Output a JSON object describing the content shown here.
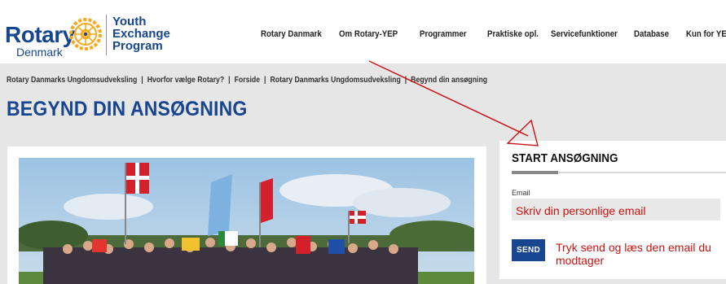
{
  "logo": {
    "rotary": "Rotary",
    "country": "Denmark",
    "program_line1": "Youth",
    "program_line2": "Exchange",
    "program_line3": "Program"
  },
  "nav": {
    "items": [
      "Rotary Danmark",
      "Om Rotary-YEP",
      "Programmer",
      "Praktiske opl.",
      "Servicefunktioner",
      "Database",
      "Kun for YEO'er"
    ]
  },
  "breadcrumb": {
    "items": [
      "Rotary Danmarks Ungdomsudveksling",
      "Hvorfor vælge Rotary?",
      "Forside",
      "Rotary Danmarks Ungdomsudveksling",
      "Begynd din ansøgning"
    ],
    "separator": "|"
  },
  "page": {
    "title": "BEGYND DIN ANSØGNING"
  },
  "form": {
    "title": "START ANSØGNING",
    "email_label": "Email",
    "email_placeholder": "Skriv din personlige email",
    "send_label": "SEND",
    "send_hint": "Tryk send og læs den email du modtager"
  },
  "colors": {
    "brand_blue": "#17458f",
    "annotation_red": "#cc1111",
    "band_gray": "#e6e6e6",
    "rotary_gold": "#f7a81b"
  },
  "icons": {
    "logo_wheel": "rotary-wheel-icon",
    "annotation": "arrow-annotation-icon"
  }
}
